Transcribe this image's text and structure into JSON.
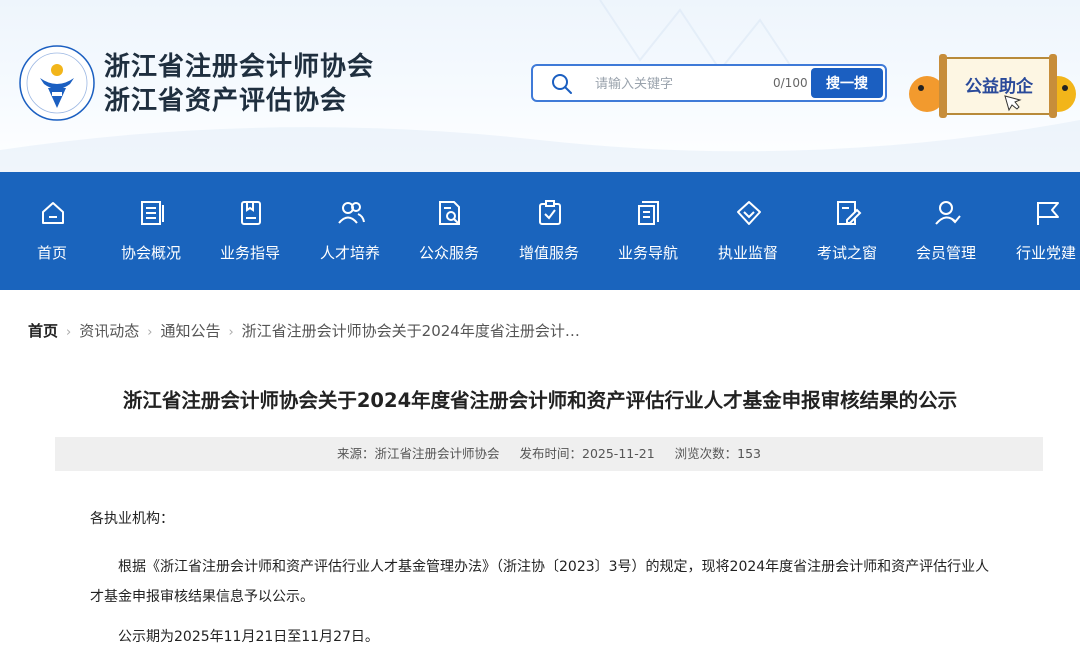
{
  "header": {
    "org_names": [
      "浙江省注册会计师协会",
      "浙江省资产评估协会"
    ],
    "logo": {
      "icon": "association-emblem-icon",
      "colors": [
        "#1b5fc1",
        "#f2b51a"
      ]
    },
    "search": {
      "placeholder": "请输入关键字",
      "count": "0/100",
      "button": "搜一搜"
    },
    "charity": {
      "label": "公益助企"
    }
  },
  "nav": {
    "items": [
      {
        "label": "首页",
        "icon": "home-icon"
      },
      {
        "label": "协会概况",
        "icon": "document-icon"
      },
      {
        "label": "业务指导",
        "icon": "guide-book-icon"
      },
      {
        "label": "人才培养",
        "icon": "people-icon"
      },
      {
        "label": "公众服务",
        "icon": "search-file-icon"
      },
      {
        "label": "增值服务",
        "icon": "clipboard-check-icon"
      },
      {
        "label": "业务导航",
        "icon": "navigation-doc-icon"
      },
      {
        "label": "执业监督",
        "icon": "diamond-shield-icon"
      },
      {
        "label": "考试之窗",
        "icon": "edit-paper-icon"
      },
      {
        "label": "会员管理",
        "icon": "member-icon"
      },
      {
        "label": "行业党建",
        "icon": "flag-icon"
      }
    ]
  },
  "breadcrumb": [
    "首页",
    "资讯动态",
    "通知公告",
    "浙江省注册会计师协会关于2024年度省注册会计…"
  ],
  "article": {
    "title": "浙江省注册会计师协会关于2024年度省注册会计师和资产评估行业人才基金申报审核结果的公示",
    "source": "来源：浙江省注册会计师协会",
    "publish_time": "发布时间：2025-11-21",
    "views": "浏览次数：153",
    "salutation": "各执业机构：",
    "body": "根据《浙江省注册会计师和资产评估行业人才基金管理办法》（浙注协〔2023〕3号）的规定，现将2024年度省注册会计师和资产评估行业人才基金申报审核结果信息予以公示。",
    "period": "公示期为2025年11月21日至11月27日。"
  },
  "colors": {
    "nav_bg": "#1a64bd",
    "accent": "#1b5fc1",
    "meta_bg": "#efefef"
  }
}
